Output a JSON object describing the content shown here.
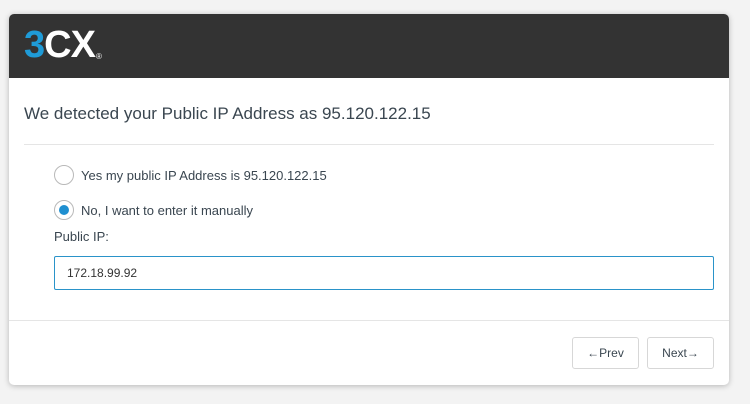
{
  "header": {
    "logo_accent": "3",
    "logo_rest": "CX",
    "logo_reg": "®"
  },
  "title": "We detected your Public IP Address as 95.120.122.15",
  "options": [
    {
      "label": "Yes my public IP Address is 95.120.122.15",
      "selected": false
    },
    {
      "label": "No, I want to enter it manually",
      "selected": true
    }
  ],
  "public_ip": {
    "label": "Public IP:",
    "value": "172.18.99.92"
  },
  "buttons": {
    "prev_arrow": "←",
    "prev_label": "Prev",
    "next_label": "Next",
    "next_arrow": "→"
  },
  "colors": {
    "accent": "#1f9bd7",
    "header_bg": "#333333",
    "input_border": "#2a93c9"
  },
  "icons": {
    "prev": "arrow-left-icon",
    "next": "arrow-right-icon",
    "radio_checked": "radio-checked-icon",
    "radio_unchecked": "radio-unchecked-icon"
  }
}
